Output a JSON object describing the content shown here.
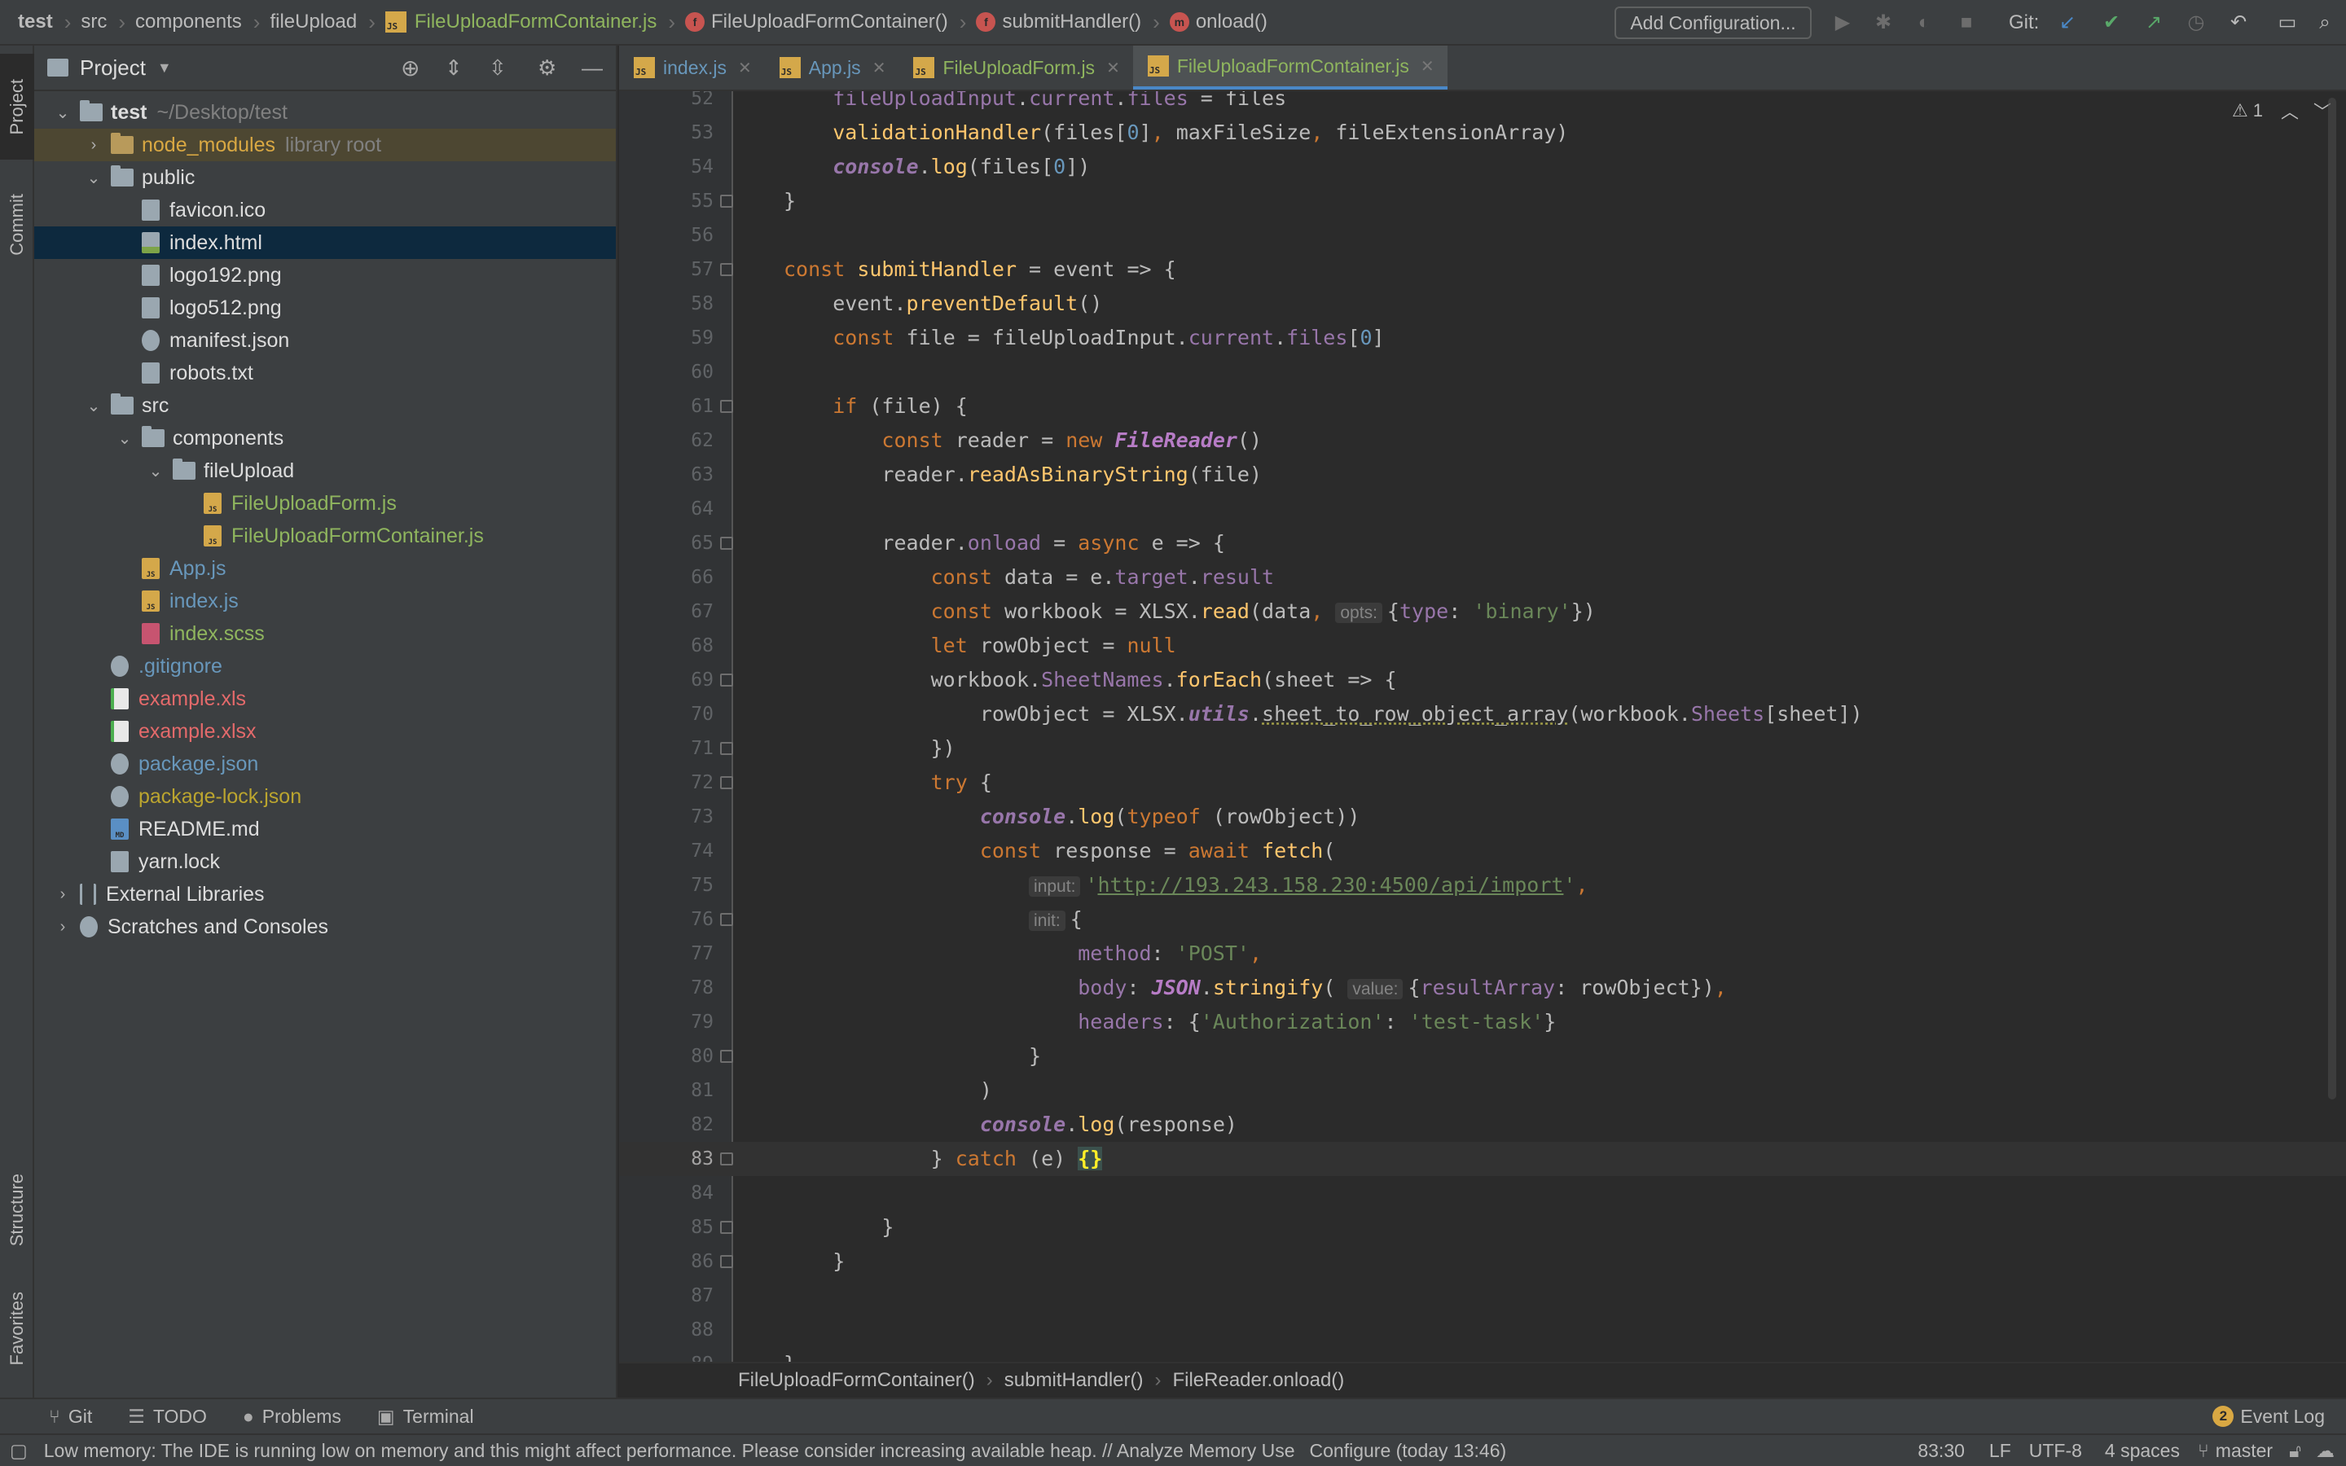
{
  "breadcrumb": {
    "items": [
      "test",
      "src",
      "components",
      "fileUpload",
      "FileUploadFormContainer.js",
      "FileUploadFormContainer()",
      "submitHandler()",
      "onload()"
    ]
  },
  "toolbar": {
    "add_configuration": "Add Configuration...",
    "git_label": "Git:"
  },
  "left_strip": {
    "project": "Project",
    "commit": "Commit",
    "structure": "Structure",
    "favorites": "Favorites"
  },
  "project_pane": {
    "title": "Project",
    "tree": [
      {
        "label": "test",
        "suffix": "~/Desktop/test",
        "depth": 0,
        "kind": "folder",
        "expanded": true,
        "color": "white",
        "bold": true
      },
      {
        "label": "node_modules",
        "suffix": "library root",
        "depth": 1,
        "kind": "folder-orange",
        "expanded": false,
        "color": "orange"
      },
      {
        "label": "public",
        "depth": 1,
        "kind": "folder",
        "expanded": true,
        "color": "white"
      },
      {
        "label": "favicon.ico",
        "depth": 2,
        "kind": "file-gray",
        "color": "white"
      },
      {
        "label": "index.html",
        "depth": 2,
        "kind": "file-html",
        "color": "white",
        "selected": true
      },
      {
        "label": "logo192.png",
        "depth": 2,
        "kind": "file-gray",
        "color": "white"
      },
      {
        "label": "logo512.png",
        "depth": 2,
        "kind": "file-gray",
        "color": "white"
      },
      {
        "label": "manifest.json",
        "depth": 2,
        "kind": "file-cfg",
        "color": "white"
      },
      {
        "label": "robots.txt",
        "depth": 2,
        "kind": "file-gray",
        "color": "white"
      },
      {
        "label": "src",
        "depth": 1,
        "kind": "folder",
        "expanded": true,
        "color": "white"
      },
      {
        "label": "components",
        "depth": 2,
        "kind": "folder",
        "expanded": true,
        "color": "white"
      },
      {
        "label": "fileUpload",
        "depth": 3,
        "kind": "folder",
        "expanded": true,
        "color": "white"
      },
      {
        "label": "FileUploadForm.js",
        "depth": 4,
        "kind": "file-js",
        "color": "green"
      },
      {
        "label": "FileUploadFormContainer.js",
        "depth": 4,
        "kind": "file-js",
        "color": "green"
      },
      {
        "label": "App.js",
        "depth": 2,
        "kind": "file-js",
        "color": "blue"
      },
      {
        "label": "index.js",
        "depth": 2,
        "kind": "file-js",
        "color": "blue"
      },
      {
        "label": "index.scss",
        "depth": 2,
        "kind": "file-sass",
        "color": "green"
      },
      {
        "label": ".gitignore",
        "depth": 1,
        "kind": "file-cfg",
        "color": "blue"
      },
      {
        "label": "example.xls",
        "depth": 1,
        "kind": "file-xls",
        "color": "red"
      },
      {
        "label": "example.xlsx",
        "depth": 1,
        "kind": "file-xls",
        "color": "red"
      },
      {
        "label": "package.json",
        "depth": 1,
        "kind": "file-cfg",
        "color": "blue"
      },
      {
        "label": "package-lock.json",
        "depth": 1,
        "kind": "file-cfg",
        "color": "yellow"
      },
      {
        "label": "README.md",
        "depth": 1,
        "kind": "file-md",
        "color": "white"
      },
      {
        "label": "yarn.lock",
        "depth": 1,
        "kind": "file-gray",
        "color": "white"
      },
      {
        "label": "External Libraries",
        "depth": 0,
        "kind": "lib",
        "expanded": false,
        "color": "white"
      },
      {
        "label": "Scratches and Consoles",
        "depth": 0,
        "kind": "scratch",
        "expanded": false,
        "color": "white"
      }
    ]
  },
  "tabs": [
    {
      "label": "index.js",
      "color": "blue",
      "active": false
    },
    {
      "label": "App.js",
      "color": "blue",
      "active": false
    },
    {
      "label": "FileUploadForm.js",
      "color": "green",
      "active": false
    },
    {
      "label": "FileUploadFormContainer.js",
      "color": "green",
      "active": true
    }
  ],
  "editor": {
    "inspection_count": "1",
    "current_line": 83,
    "lines": [
      {
        "n": "52",
        "html": "    <span class='pr'>fileUploadInput</span>.<span class='pr'>current</span>.<span class='pr'>files</span> = files"
      },
      {
        "n": "53",
        "html": "    <span class='fn'>validationHandler</span>(files[<span class='nm'>0</span>]<span class='kw'>,</span> maxFileSize<span class='kw'>,</span> fileExtensionArray)"
      },
      {
        "n": "54",
        "html": "    <span class='it'>console</span>.<span class='fn'>log</span>(files[<span class='nm'>0</span>])"
      },
      {
        "n": "55",
        "fold": true,
        "html": "}"
      },
      {
        "n": "56",
        "html": ""
      },
      {
        "n": "57",
        "fold": true,
        "html": "<span class='kw'>const</span> <span class='fn'>submitHandler</span> = event => {"
      },
      {
        "n": "58",
        "html": "    event.<span class='fn'>preventDefault</span>()"
      },
      {
        "n": "59",
        "html": "    <span class='kw'>const</span> file = fileUploadInput.<span class='pr'>current</span>.<span class='pr'>files</span>[<span class='nm'>0</span>]"
      },
      {
        "n": "60",
        "html": ""
      },
      {
        "n": "61",
        "fold": true,
        "html": "    <span class='kw'>if</span> (file) {"
      },
      {
        "n": "62",
        "html": "        <span class='kw'>const</span> reader = <span class='kw'>new</span> <span class='cl'>FileReader</span>()"
      },
      {
        "n": "63",
        "html": "        reader.<span class='fn'>readAsBinaryString</span>(file)"
      },
      {
        "n": "64",
        "html": ""
      },
      {
        "n": "65",
        "fold": true,
        "html": "        reader.<span class='pr'>onload</span> = <span class='kw'>async</span> e => {"
      },
      {
        "n": "66",
        "html": "            <span class='kw'>const</span> data = e.<span class='pr'>target</span>.<span class='pr'>result</span>"
      },
      {
        "n": "67",
        "html": "            <span class='kw'>const</span> workbook = XLSX.<span class='fn'>read</span>(data<span class='kw'>,</span> <span class='hint'>opts:</span>{<span class='pr'>type</span>: <span class='st'>'binary'</span>})"
      },
      {
        "n": "68",
        "html": "            <span class='kw'>let</span> rowObject = <span class='kw'>null</span>"
      },
      {
        "n": "69",
        "fold": true,
        "html": "            workbook.<span class='pr'>SheetNames</span>.<span class='fn'>forEach</span>(sheet => {"
      },
      {
        "n": "70",
        "html": "                rowObject = XLSX.<span class='it'>utils</span>.<span class='wavy'>sheet_to_row_object_array</span>(workbook.<span class='pr'>Sheets</span>[sheet])"
      },
      {
        "n": "71",
        "fold": true,
        "html": "            })"
      },
      {
        "n": "72",
        "fold": true,
        "html": "            <span class='kw'>try</span> {"
      },
      {
        "n": "73",
        "html": "                <span class='it'>console</span>.<span class='fn'>log</span>(<span class='kw'>typeof</span> (rowObject))"
      },
      {
        "n": "74",
        "html": "                <span class='kw'>const</span> response = <span class='kw'>await</span> <span class='fn'>fetch</span>("
      },
      {
        "n": "75",
        "html": "                    <span class='hint'>input:</span><span class='st'>'</span><span class='url'>http://193.243.158.230:4500/api/import</span><span class='st'>'</span><span class='kw'>,</span>"
      },
      {
        "n": "76",
        "fold": true,
        "html": "                    <span class='hint'>init:</span>{"
      },
      {
        "n": "77",
        "html": "                        <span class='pr'>method</span>: <span class='st'>'POST'</span><span class='kw'>,</span>"
      },
      {
        "n": "78",
        "html": "                        <span class='pr'>body</span>: <span class='cl'>JSON</span>.<span class='fn'>stringify</span>( <span class='hint'>value:</span>{<span class='pr'>resultArray</span>: rowObject})<span class='kw'>,</span>"
      },
      {
        "n": "79",
        "html": "                        <span class='pr'>headers</span>: {<span class='st'>'Authorization'</span>: <span class='st'>'test-task'</span>}"
      },
      {
        "n": "80",
        "fold": true,
        "html": "                    }"
      },
      {
        "n": "81",
        "html": "                )"
      },
      {
        "n": "82",
        "html": "                <span class='it'>console</span>.<span class='fn'>log</span>(response)"
      },
      {
        "n": "83",
        "fold": true,
        "cur": true,
        "html": "            } <span class='kw'>catch</span> (e) <span class='brc'>{}</span>"
      },
      {
        "n": "84",
        "html": ""
      },
      {
        "n": "85",
        "fold": true,
        "html": "        }"
      },
      {
        "n": "86",
        "fold": true,
        "html": "    }"
      },
      {
        "n": "87",
        "html": ""
      },
      {
        "n": "88",
        "html": ""
      },
      {
        "n": "89",
        "html": "}"
      }
    ]
  },
  "editor_breadcrumb": [
    "FileUploadFormContainer()",
    "submitHandler()",
    "FileReader.onload()"
  ],
  "bottom_tools": {
    "git": "Git",
    "todo": "TODO",
    "problems": "Problems",
    "terminal": "Terminal",
    "event_log": "Event Log",
    "event_count": "2"
  },
  "status": {
    "message": "Low memory: The IDE is running low on memory and this might affect performance. Please consider increasing available heap. // Analyze Memory Use",
    "configure": "Configure (today 13:46)",
    "position": "83:30",
    "line_sep": "LF",
    "encoding": "UTF-8",
    "indent": "4 spaces",
    "branch": "master"
  }
}
